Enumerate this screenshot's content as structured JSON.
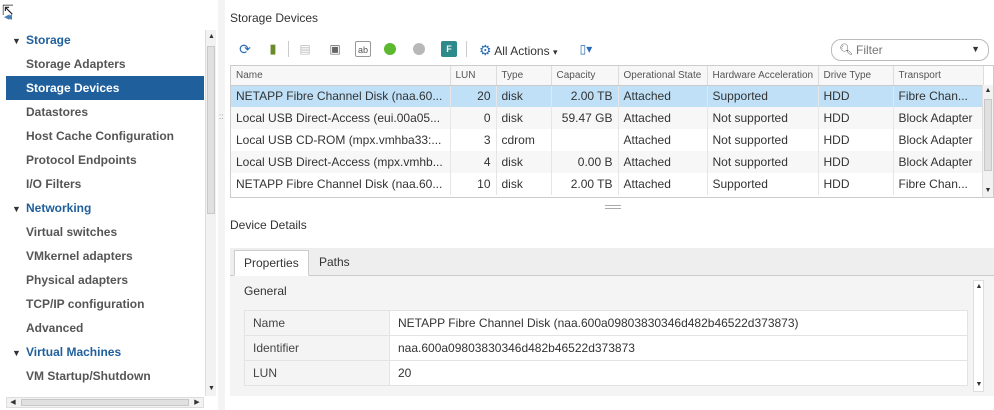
{
  "nav": {
    "items": [
      {
        "kind": "group",
        "label": "Storage"
      },
      {
        "kind": "item",
        "label": "Storage Adapters"
      },
      {
        "kind": "item",
        "label": "Storage Devices",
        "selected": true
      },
      {
        "kind": "item",
        "label": "Datastores"
      },
      {
        "kind": "item",
        "label": "Host Cache Configuration"
      },
      {
        "kind": "item",
        "label": "Protocol Endpoints"
      },
      {
        "kind": "item",
        "label": "I/O Filters"
      },
      {
        "kind": "group",
        "label": "Networking"
      },
      {
        "kind": "item",
        "label": "Virtual switches"
      },
      {
        "kind": "item",
        "label": "VMkernel adapters"
      },
      {
        "kind": "item",
        "label": "Physical adapters"
      },
      {
        "kind": "item",
        "label": "TCP/IP configuration"
      },
      {
        "kind": "item",
        "label": "Advanced"
      },
      {
        "kind": "group",
        "label": "Virtual Machines"
      },
      {
        "kind": "item",
        "label": "VM Startup/Shutdown"
      }
    ]
  },
  "main": {
    "title": "Storage Devices",
    "toolbar": {
      "all_actions_label": "All Actions",
      "icons": [
        "refresh-icon",
        "rescan-storage-icon",
        "detach-icon",
        "attach-icon",
        "rename-icon",
        "turn-on-led-icon",
        "turn-off-led-icon",
        "mark-flash-icon",
        "copy-to-clipboard-icon"
      ]
    },
    "filter": {
      "placeholder": "Filter"
    },
    "grid": {
      "columns": [
        "Name",
        "LUN",
        "Type",
        "Capacity",
        "Operational State",
        "Hardware Acceleration",
        "Drive Type",
        "Transport"
      ],
      "rows": [
        [
          "NETAPP Fibre Channel Disk (naa.60...",
          "20",
          "disk",
          "2.00 TB",
          "Attached",
          "Supported",
          "HDD",
          "Fibre Chan..."
        ],
        [
          "Local USB Direct-Access (eui.00a05...",
          "0",
          "disk",
          "59.47 GB",
          "Attached",
          "Not supported",
          "HDD",
          "Block Adapter"
        ],
        [
          "Local USB CD-ROM (mpx.vmhba33:...",
          "3",
          "cdrom",
          "",
          "Attached",
          "Not supported",
          "HDD",
          "Block Adapter"
        ],
        [
          "Local USB Direct-Access (mpx.vmhb...",
          "4",
          "disk",
          "0.00 B",
          "Attached",
          "Not supported",
          "HDD",
          "Block Adapter"
        ],
        [
          "NETAPP Fibre Channel Disk (naa.60...",
          "10",
          "disk",
          "2.00 TB",
          "Attached",
          "Supported",
          "HDD",
          "Fibre Chan..."
        ]
      ],
      "selected_row": 0
    },
    "details": {
      "title": "Device Details",
      "tabs": [
        "Properties",
        "Paths"
      ],
      "active_tab": 0,
      "section": "General",
      "properties": [
        {
          "key": "Name",
          "value": "NETAPP Fibre Channel Disk (naa.600a09803830346d482b46522d373873)"
        },
        {
          "key": "Identifier",
          "value": "naa.600a09803830346d482b46522d373873"
        },
        {
          "key": "LUN",
          "value": "20"
        }
      ]
    }
  },
  "colors": {
    "selected_nav": "#1f5f9c",
    "selected_row": "#bfe0f7",
    "group_text": "#1f5f9c"
  }
}
